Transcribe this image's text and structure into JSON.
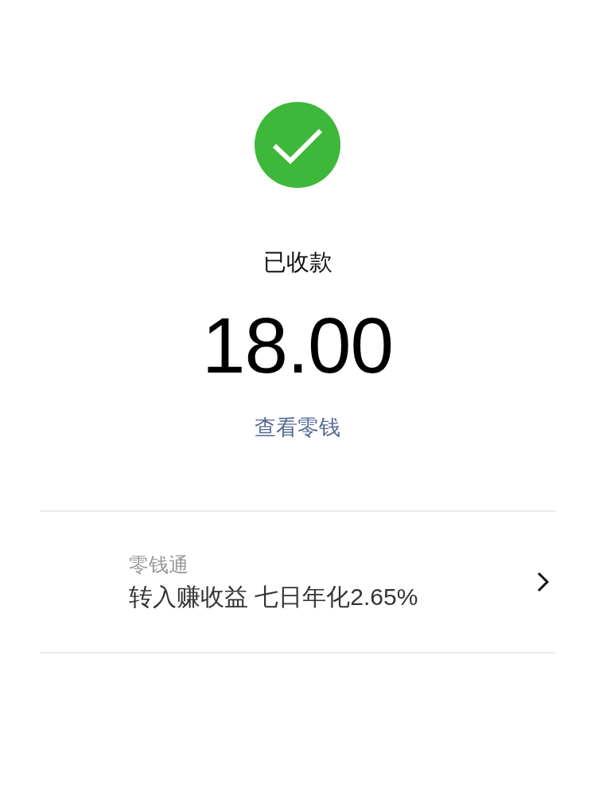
{
  "status": {
    "title": "已收款",
    "amount": "18.00",
    "link": "查看零钱"
  },
  "promo": {
    "title": "零钱通",
    "text": "转入赚收益 七日年化2.65%"
  }
}
